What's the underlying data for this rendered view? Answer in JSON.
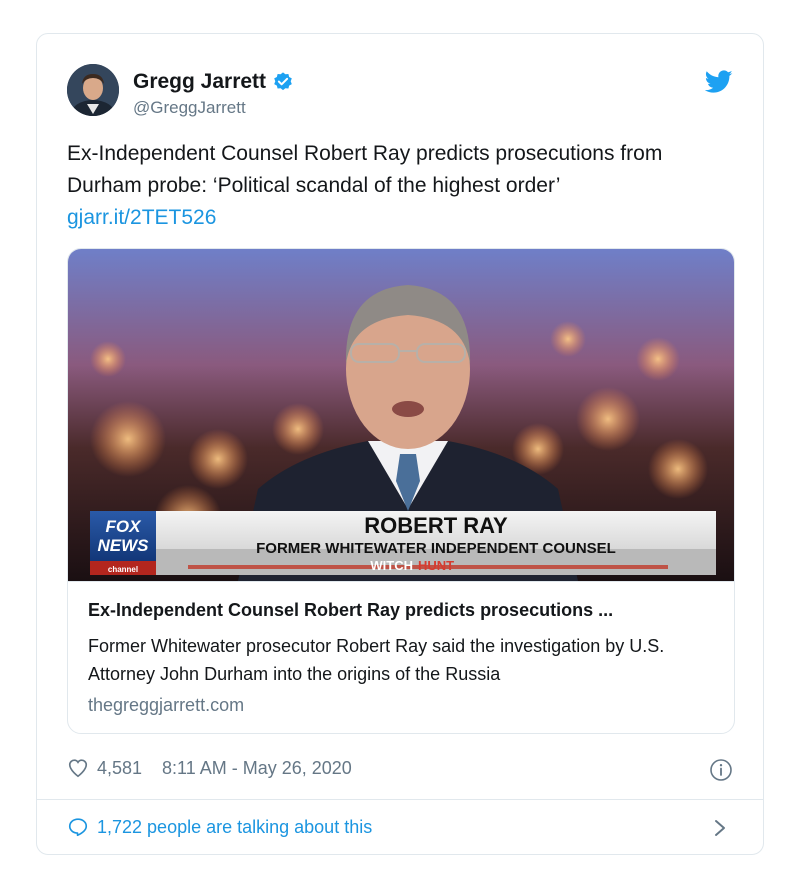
{
  "tweet": {
    "display_name": "Gregg Jarrett",
    "handle": "@GreggJarrett",
    "text": "Ex-Independent Counsel Robert Ray predicts prosecutions from Durham probe: ‘Political scandal of the highest order’",
    "link": "gjarr.it/2TET526",
    "likes": "4,581",
    "timestamp": "8:11 AM - May 26, 2020",
    "talking": "1,722 people are talking about this"
  },
  "card": {
    "title": "Ex-Independent Counsel Robert Ray predicts prosecutions ...",
    "description": "Former Whitewater prosecutor Robert Ray said the investigation by U.S. Attorney John Durham into the origins of the Russia",
    "domain": "thegreggjarrett.com",
    "chyron_name": "ROBERT RAY",
    "chyron_title": "FORMER WHITEWATER INDEPENDENT COUNSEL",
    "chyron_ticker": "WITCH",
    "chyron_ticker_red": "HUNT",
    "logo_line1": "FOX",
    "logo_line2": "NEWS",
    "logo_line3": "channel"
  },
  "colors": {
    "accent": "#1b95e0",
    "verified": "#1da1f2",
    "text": "#14171a",
    "muted": "#657786",
    "border": "#e1e8ed"
  },
  "icons": {
    "verified": "verified-badge-icon",
    "bird": "twitter-bird-icon",
    "heart": "heart-icon",
    "info": "info-icon",
    "bubble": "speech-bubble-icon",
    "chevron": "chevron-right-icon"
  }
}
